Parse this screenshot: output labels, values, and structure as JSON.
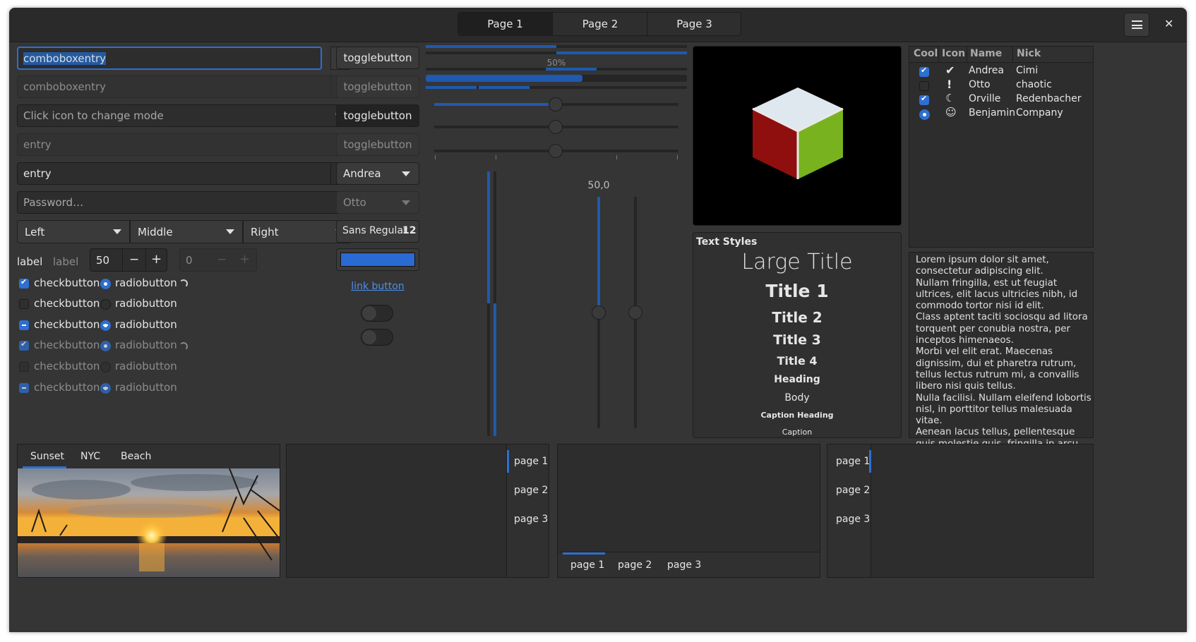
{
  "header": {
    "tabs": [
      "Page 1",
      "Page 2",
      "Page 3"
    ],
    "menu_icon": "hamburger-menu-icon",
    "close_icon": "close-icon"
  },
  "left": {
    "combo1": {
      "value": "comboboxentry"
    },
    "combo2": {
      "value": "comboboxentry"
    },
    "mode_entry": {
      "placeholder": "Click icon to change mode"
    },
    "entry_disabled": {
      "placeholder": "entry"
    },
    "entry_clear": {
      "value": "entry"
    },
    "password": {
      "placeholder": "Password…"
    },
    "dropdowns": [
      "Left",
      "Middle",
      "Right"
    ],
    "label1": "label",
    "label2": "label",
    "spin1": "50",
    "spin2": "0",
    "checks": [
      "checkbutton",
      "checkbutton",
      "checkbutton",
      "checkbutton",
      "checkbutton",
      "checkbutton"
    ],
    "radios": [
      "radiobutton",
      "radiobutton",
      "radiobutton",
      "radiobutton",
      "radiobutton",
      "radiobutton"
    ]
  },
  "buttons": {
    "toggles": [
      "togglebutton",
      "togglebutton",
      "togglebutton",
      "togglebutton"
    ],
    "combo_andrea": "Andrea",
    "combo_otto": "Otto",
    "font_name": "Sans Regular",
    "font_size": "12",
    "color_swatch": "#2a6bd3",
    "link": "link button"
  },
  "sliders": {
    "progress_label": "50%",
    "scale_value": "50,0"
  },
  "text_styles": {
    "heading": "Text Styles",
    "items": [
      "Large Title",
      "Title 1",
      "Title 2",
      "Title 3",
      "Title 4",
      "Heading",
      "Body",
      "Caption Heading",
      "Caption"
    ]
  },
  "tree": {
    "columns": [
      "Cool",
      "Icon",
      "Name",
      "Nick"
    ],
    "rows": [
      {
        "name": "Andrea",
        "nick": "Cimi",
        "icon": "check-circle-icon"
      },
      {
        "name": "Otto",
        "nick": "chaotic",
        "icon": "exclamation-circle-icon"
      },
      {
        "name": "Orville",
        "nick": "Redenbacher",
        "icon": "moon-icon"
      },
      {
        "name": "Benjamin",
        "nick": "Company",
        "icon": "face-icon"
      }
    ]
  },
  "lorem": [
    "Lorem ipsum dolor sit amet, consectetur adipiscing elit.",
    "Nullam fringilla, est ut feugiat ultrices, elit lacus ultricies nibh, id commodo tortor nisi id elit.",
    "Class aptent taciti sociosqu ad litora torquent per conubia nostra, per inceptos himenaeos.",
    "Morbi vel elit erat. Maecenas dignissim, dui et pharetra rutrum, tellus lectus rutrum mi, a convallis libero nisi quis tellus.",
    "Nulla facilisi. Nullam eleifend lobortis nisl, in porttitor tellus malesuada vitae.",
    "Aenean lacus tellus, pellentesque quis molestie quis, fringilla in arcu."
  ],
  "notebook1": {
    "tabs": [
      "Sunset",
      "NYC",
      "Beach"
    ]
  },
  "notebook_pages": [
    "page 1",
    "page 2",
    "page 3"
  ]
}
